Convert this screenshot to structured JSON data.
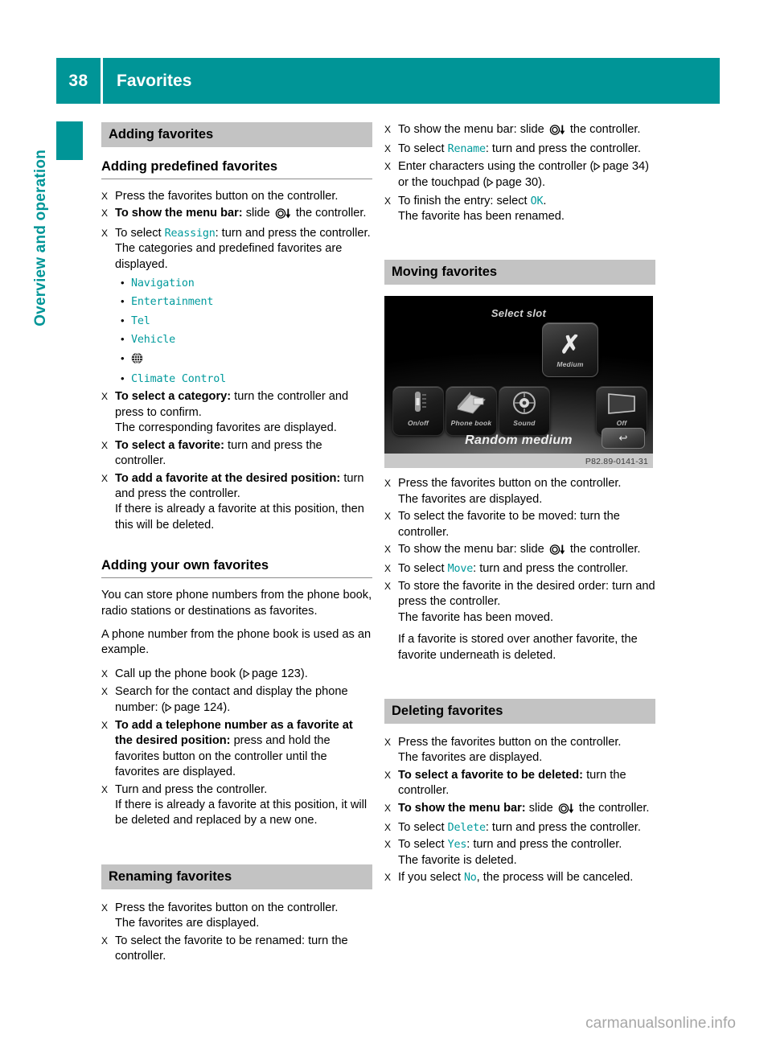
{
  "header": {
    "page_number": "38",
    "title": "Favorites",
    "accent_color": "#009597"
  },
  "side_tab": {
    "label": "Overview and operation"
  },
  "icons": {
    "step_marker": "X",
    "bullet_dot": "•",
    "page_ref_triangle": "▷",
    "globe": "globe-icon",
    "controller_slide": "controller-slide-icon"
  },
  "left_column": {
    "band_heading": "Adding favorites",
    "section_1": {
      "sub_heading": "Adding predefined favorites",
      "steps": [
        {
          "text": "Press the favorites button on the controller."
        },
        {
          "bold": "To show the menu bar:",
          "text": " slide ",
          "icon": "controller-slide",
          "text_after": " the controller."
        },
        {
          "text_before": "To select ",
          "ui": "Reassign",
          "text_after": ": turn and press the controller.",
          "follow": "The categories and predefined favorites are displayed."
        }
      ],
      "categories": [
        {
          "label": "Navigation",
          "type": "ui"
        },
        {
          "label": "Entertainment",
          "type": "ui"
        },
        {
          "label": "Tel",
          "type": "ui"
        },
        {
          "label": "Vehicle",
          "type": "ui"
        },
        {
          "label": "",
          "type": "globe-icon"
        },
        {
          "label": "Climate Control",
          "type": "ui"
        }
      ],
      "steps_after": [
        {
          "bold": "To select a category:",
          "text": " turn the controller and press to confirm.",
          "follow": "The corresponding favorites are displayed."
        },
        {
          "bold": "To select a favorite:",
          "text": " turn and press the controller."
        },
        {
          "bold": "To add a favorite at the desired position:",
          "text": " turn and press the controller.",
          "follow": "If there is already a favorite at this position, then this will be deleted."
        }
      ]
    },
    "section_2": {
      "sub_heading": "Adding your own favorites",
      "intro_1": "You can store phone numbers from the phone book, radio stations or destinations as favorites.",
      "intro_2": "A phone number from the phone book is used as an example.",
      "steps": [
        {
          "text_before": "Call up the phone book (",
          "ref": "page 123",
          "text_after": ")."
        },
        {
          "text_before": "Search for the contact and display the phone number: (",
          "ref": "page 124",
          "text_after": ")."
        },
        {
          "bold": "To add a telephone number as a favorite at the desired position:",
          "text": " press and hold the favorites button on the controller until the favorites are displayed."
        },
        {
          "text": "Turn and press the controller.",
          "follow": "If there is already a favorite at this position, it will be deleted and replaced by a new one."
        }
      ]
    },
    "section_3": {
      "band_heading": "Renaming favorites",
      "steps": [
        {
          "text": "Press the favorites button on the controller.",
          "follow": "The favorites are displayed."
        },
        {
          "text": "To select the favorite to be renamed: turn the controller."
        }
      ]
    }
  },
  "right_column": {
    "section_rename_cont": {
      "steps": [
        {
          "text_before": "To show the menu bar: slide ",
          "icon": "controller-slide",
          "text_after": " the controller."
        },
        {
          "text_before": "To select ",
          "ui": "Rename",
          "text_after": ": turn and press the controller."
        },
        {
          "text_before": "Enter characters using the controller (",
          "ref": "page 34",
          "text_mid": ") or the touchpad (",
          "ref2": "page 30",
          "text_after": ")."
        },
        {
          "text_before": "To finish the entry: select ",
          "ui": "OK",
          "text_after": ".",
          "follow": "The favorite has been renamed."
        }
      ]
    },
    "section_moving": {
      "band_heading": "Moving favorites",
      "figure": {
        "screen_title": "Select slot",
        "selected_tile_label": "Medium",
        "selected_tile_glyph": "✗",
        "tiles": [
          {
            "label": "On/off",
            "icon": "slider-icon"
          },
          {
            "label": "Phone book",
            "icon": "phonebook-icon"
          },
          {
            "label": "Sound",
            "icon": "sound-icon"
          },
          {
            "label": "Off",
            "icon": "display-off-icon"
          }
        ],
        "footer_text": "Random medium",
        "back_chip": "↩",
        "caption": "P82.89-0141-31"
      },
      "steps": [
        {
          "text": "Press the favorites button on the controller.",
          "follow": "The favorites are displayed."
        },
        {
          "text": "To select the favorite to be moved: turn the controller."
        },
        {
          "text_before": "To show the menu bar: slide ",
          "icon": "controller-slide",
          "text_after": " the controller."
        },
        {
          "text_before": "To select ",
          "ui": "Move",
          "text_after": ": turn and press the controller."
        },
        {
          "text": "To store the favorite in the desired order: turn and press the controller.",
          "follow": "The favorite has been moved.",
          "note": "If a favorite is stored over another favorite, the favorite underneath is deleted."
        }
      ]
    },
    "section_deleting": {
      "band_heading": "Deleting favorites",
      "steps": [
        {
          "text": "Press the favorites button on the controller.",
          "follow": "The favorites are displayed."
        },
        {
          "bold": "To select a favorite to be deleted:",
          "text": " turn the controller."
        },
        {
          "bold": "To show the menu bar:",
          "text": " slide ",
          "icon": "controller-slide",
          "text_after": " the controller."
        },
        {
          "text_before": "To select ",
          "ui": "Delete",
          "text_after": ": turn and press the controller."
        },
        {
          "text_before": "To select ",
          "ui": "Yes",
          "text_after": ": turn and press the controller.",
          "follow": "The favorite is deleted."
        },
        {
          "text_before": "If you select ",
          "ui": "No",
          "text_after": ", the process will be canceled."
        }
      ]
    }
  },
  "watermark": "carmanualsonline.info"
}
